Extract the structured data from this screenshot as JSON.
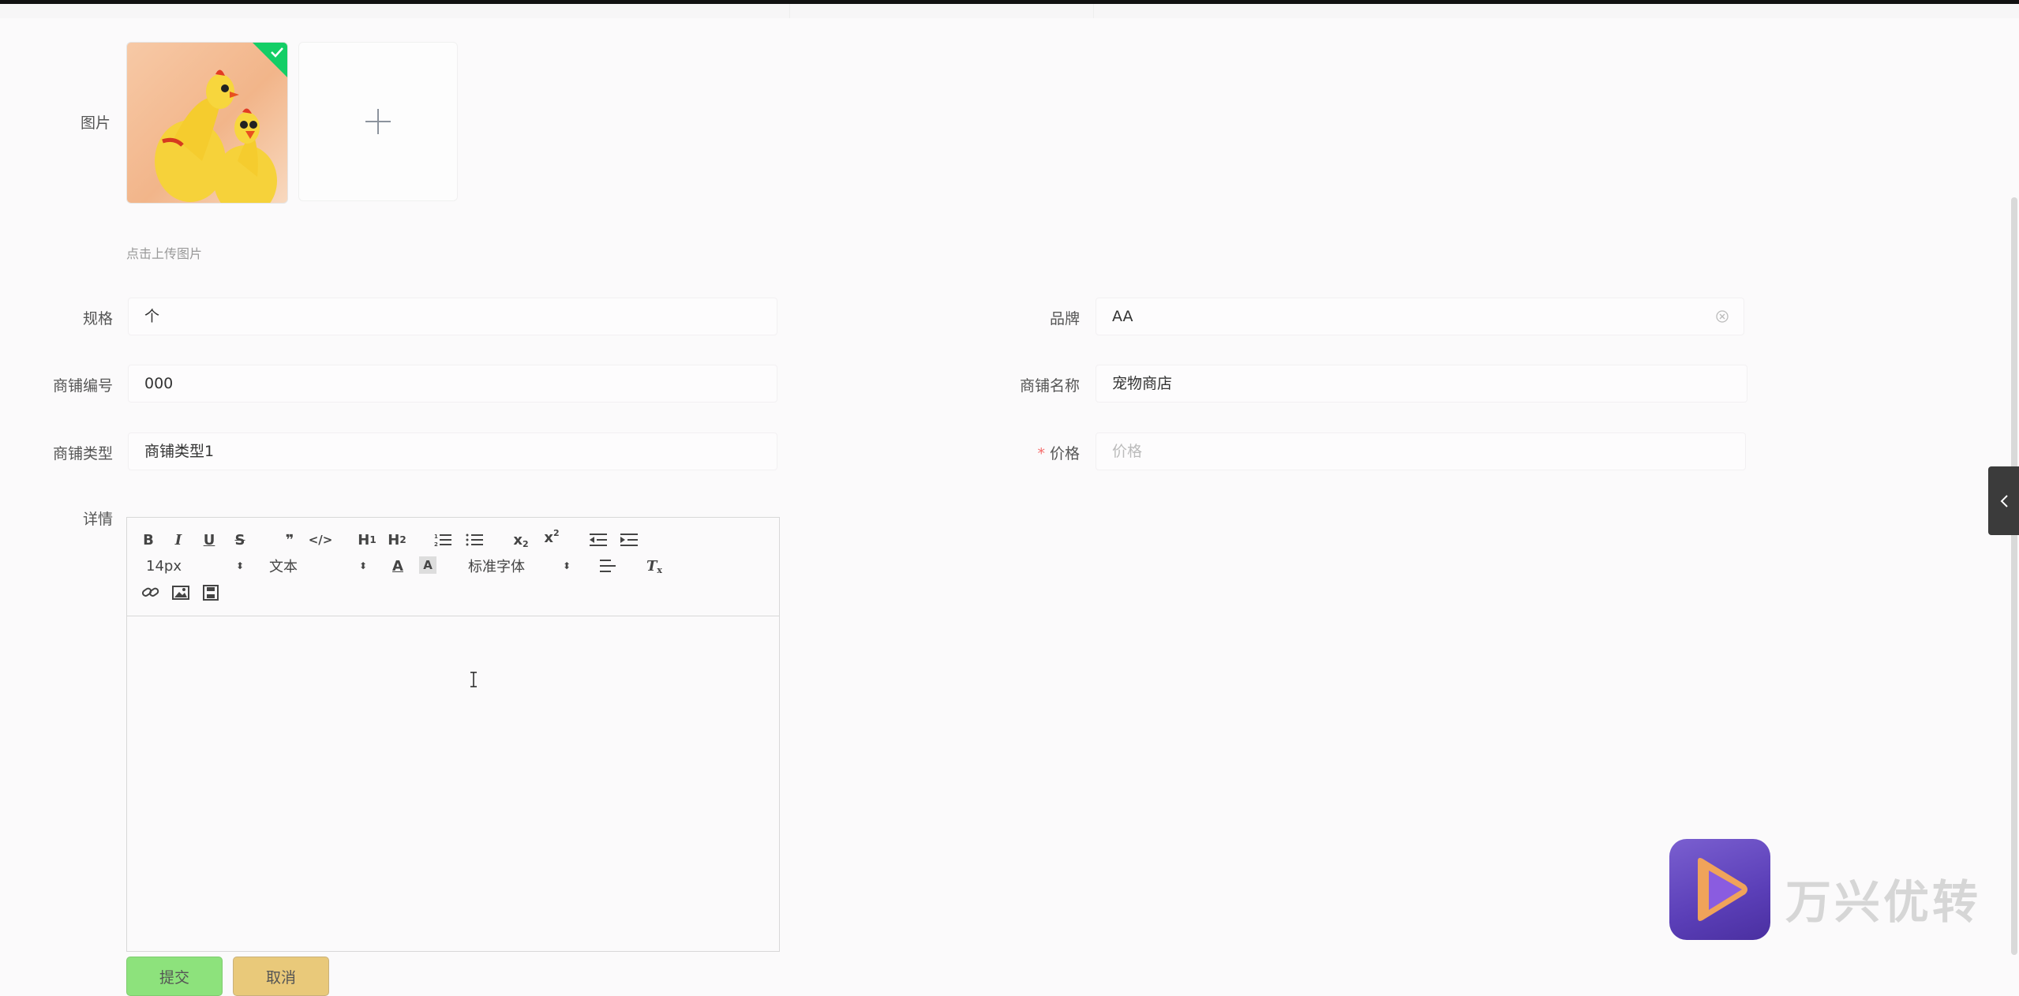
{
  "form": {
    "image_label": "图片",
    "upload_tip": "点击上传图片",
    "spec_label": "规格",
    "spec_value": "个",
    "brand_label": "品牌",
    "brand_value": "AA",
    "shop_no_label": "商铺编号",
    "shop_no_value": "000",
    "shop_name_label": "商铺名称",
    "shop_name_value": "宠物商店",
    "shop_type_label": "商铺类型",
    "shop_type_value": "商铺类型1",
    "price_required_mark": "*",
    "price_label": "价格",
    "price_placeholder": "价格",
    "detail_label": "详情"
  },
  "editor": {
    "font_size": "14px",
    "block_format": "文本",
    "font_family": "标准字体",
    "buttons": [
      "bold",
      "italic",
      "underline",
      "strike",
      "blockquote",
      "code",
      "h1",
      "h2",
      "ordered-list",
      "bullet-list",
      "subscript",
      "superscript",
      "indent-decrease",
      "indent-increase",
      "font-color",
      "background-color",
      "align-left",
      "clear-format",
      "link",
      "image",
      "video"
    ]
  },
  "actions": {
    "submit_label": "提交",
    "cancel_label": "取消"
  },
  "watermark": {
    "text": "万兴优转"
  },
  "colors": {
    "submit_bg": "#8de27c",
    "cancel_bg": "#e9c97a",
    "required": "#f56c6c",
    "upload_success": "#13ce66"
  }
}
